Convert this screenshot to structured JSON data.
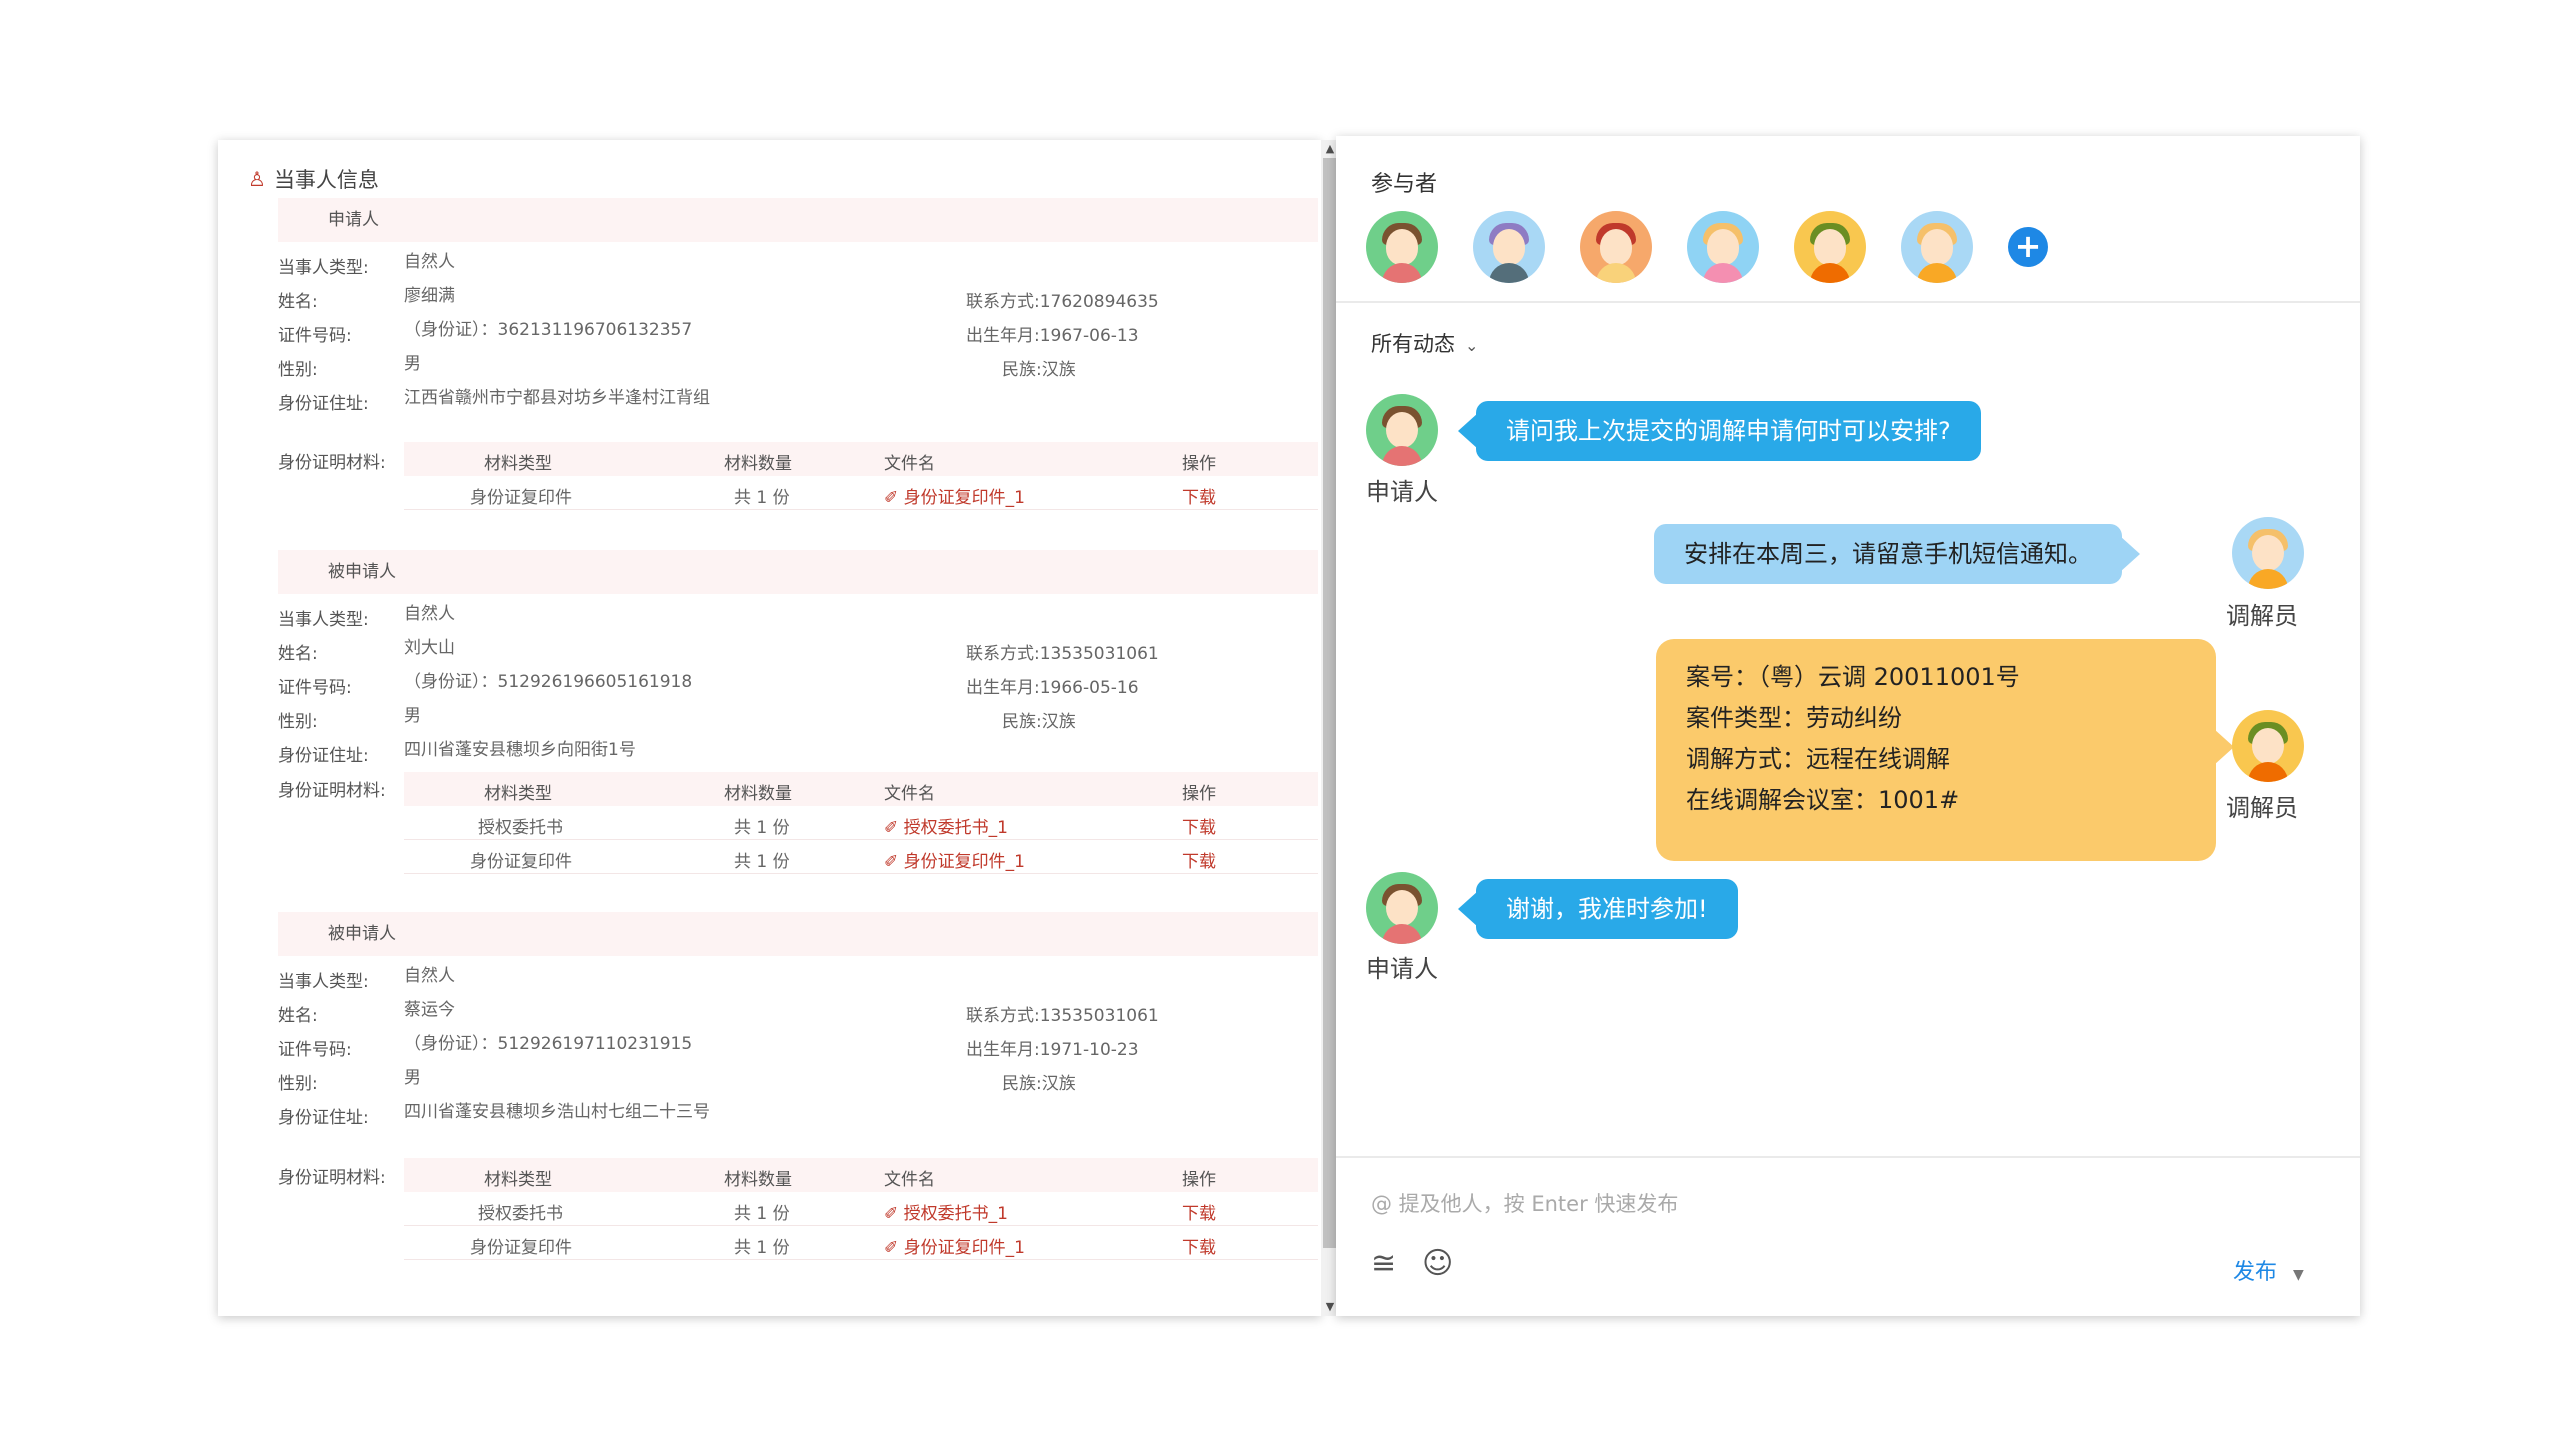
{
  "left": {
    "title": "当事人信息",
    "parties": [
      {
        "header": "申请人",
        "type_label": "当事人类型:",
        "type_value": "自然人",
        "name_label": "姓名:",
        "name_value": "廖细满",
        "contact": "联系方式:17620894635",
        "id_label": "证件号码:",
        "id_value": "（身份证）：362131196706132357",
        "birth": "出生年月:1967-06-13",
        "gender_label": "性别:",
        "gender_value": "男",
        "ethnic": "民族:汉族",
        "addr_label": "身份证住址:",
        "addr_value": "江西省赣州市宁都县对坊乡半逢村江背组",
        "mat_label": "身份证明材料:",
        "mat_head": [
          "材料类型",
          "材料数量",
          "文件名",
          "操作"
        ],
        "materials": [
          {
            "type": "身份证复印件",
            "count": "共 1 份",
            "file": "身份证复印件_1",
            "op": "下载"
          }
        ]
      },
      {
        "header": "被申请人",
        "type_label": "当事人类型:",
        "type_value": "自然人",
        "name_label": "姓名:",
        "name_value": "刘大山",
        "contact": "联系方式:13535031061",
        "id_label": "证件号码:",
        "id_value": "（身份证）：512926196605161918",
        "birth": "出生年月:1966-05-16",
        "gender_label": "性别:",
        "gender_value": "男",
        "ethnic": "民族:汉族",
        "addr_label": "身份证住址:",
        "addr_value": "四川省蓬安县穗坝乡向阳街1号",
        "mat_label": "身份证明材料:",
        "mat_head": [
          "材料类型",
          "材料数量",
          "文件名",
          "操作"
        ],
        "materials": [
          {
            "type": "授权委托书",
            "count": "共 1 份",
            "file": "授权委托书_1",
            "op": "下载"
          },
          {
            "type": "身份证复印件",
            "count": "共 1 份",
            "file": "身份证复印件_1",
            "op": "下载"
          }
        ]
      },
      {
        "header": "被申请人",
        "type_label": "当事人类型:",
        "type_value": "自然人",
        "name_label": "姓名:",
        "name_value": "蔡运今",
        "contact": "联系方式:13535031061",
        "id_label": "证件号码:",
        "id_value": "（身份证）：512926197110231915",
        "birth": "出生年月:1971-10-23",
        "gender_label": "性别:",
        "gender_value": "男",
        "ethnic": "民族:汉族",
        "addr_label": "身份证住址:",
        "addr_value": "四川省蓬安县穗坝乡浩山村七组二十三号",
        "mat_label": "身份证明材料:",
        "mat_head": [
          "材料类型",
          "材料数量",
          "文件名",
          "操作"
        ],
        "materials": [
          {
            "type": "授权委托书",
            "count": "共 1 份",
            "file": "授权委托书_1",
            "op": "下载"
          },
          {
            "type": "身份证复印件",
            "count": "共 1 份",
            "file": "身份证复印件_1",
            "op": "下载"
          }
        ]
      }
    ]
  },
  "right": {
    "participants_title": "参与者",
    "filter_label": "所有动态",
    "messages": [
      {
        "sender": "申请人",
        "text": "请问我上次提交的调解申请何时可以安排?"
      },
      {
        "sender": "调解员",
        "text": "安排在本周三，请留意手机短信通知。"
      },
      {
        "sender": "调解员",
        "lines": [
          "案号：（粤）云调 20011001号",
          "案件类型：劳动纠纷",
          "调解方式：远程在线调解",
          "在线调解会议室：1001#"
        ]
      },
      {
        "sender": "申请人",
        "text": "谢谢，我准时参加!"
      }
    ],
    "input_placeholder": "@ 提及他人，按 Enter 快速发布",
    "publish_label": "发布"
  },
  "colors": {
    "accent_blue": "#1e88e5",
    "bubble_blue": "#29a9e8",
    "bubble_light": "#9ed4f5",
    "card_yellow": "#fbca6b",
    "link_red": "#c0392b"
  },
  "icons": {
    "title": "users-icon",
    "attach": "paperclip-icon",
    "emoji": "smile-icon",
    "add": "plus-icon",
    "filter": "chevron-down-icon",
    "publish": "caret-down-icon"
  }
}
